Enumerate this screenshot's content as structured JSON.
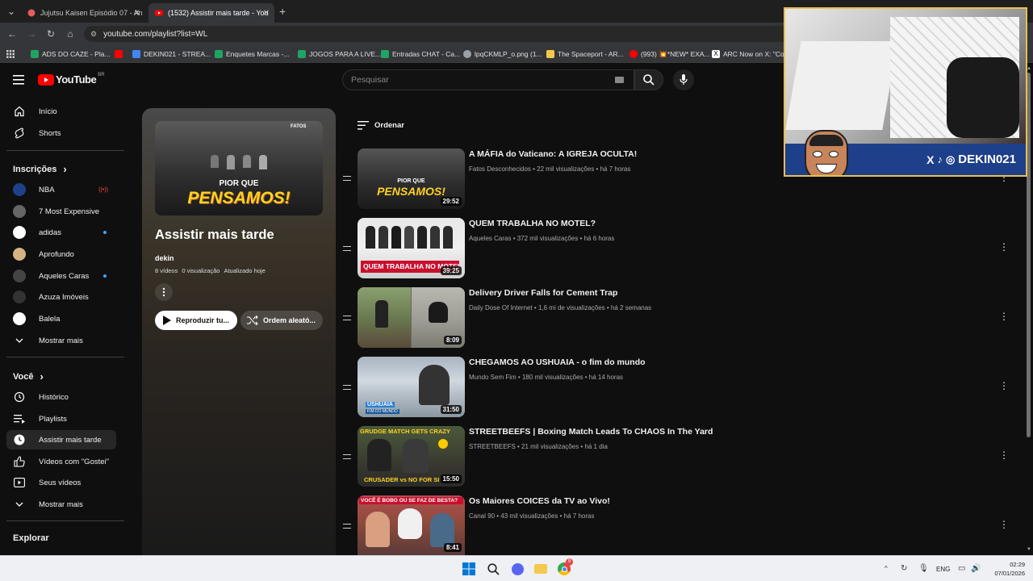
{
  "browser": {
    "tabs": [
      {
        "title": "Jujutsu Kaisen Episódio 07 - An",
        "active": false
      },
      {
        "title": "(1532) Assistir mais tarde - You",
        "active": true
      }
    ],
    "new_tab": "+",
    "url": "youtube.com/playlist?list=WL",
    "bookmarks": [
      {
        "label": "ADS DO CAZE - Pla...",
        "color": "#1fa463"
      },
      {
        "label": "",
        "color": "#ff0000"
      },
      {
        "label": "DEKIN021 - STREA...",
        "color": "#4285f4"
      },
      {
        "label": "Enquetes Marcas -...",
        "color": "#1fa463"
      },
      {
        "label": "JOGOS PARA A LIVE...",
        "color": "#1fa463"
      },
      {
        "label": "Entradas CHAT - Ca...",
        "color": "#1fa463"
      },
      {
        "label": "lpqCKMLP_o.png (1...",
        "color": "#9aa0a6"
      },
      {
        "label": "The Spaceport - AR...",
        "color": "#f2c94c"
      },
      {
        "label": "(993) 💥*NEW* EXA...",
        "color": "#ff0000"
      },
      {
        "label": "ARC Now on X: \"Co...",
        "color": "#ffffff"
      }
    ]
  },
  "youtube": {
    "logo_text": "YouTube",
    "region": "BR",
    "search_placeholder": "Pesquisar"
  },
  "sidebar": {
    "main": [
      {
        "label": "Início",
        "icon": "home-icon"
      },
      {
        "label": "Shorts",
        "icon": "shorts-icon"
      }
    ],
    "subs_header": "Inscrições",
    "subs_chevron": "›",
    "subscriptions": [
      {
        "label": "NBA",
        "color": "#1d428a",
        "live": true
      },
      {
        "label": "7 Most Expensive",
        "color": "#666666",
        "live": false
      },
      {
        "label": "adidas",
        "color": "#ffffff",
        "live": false,
        "dot": true
      },
      {
        "label": "Aprofundo",
        "color": "#d4b483",
        "live": false
      },
      {
        "label": "Aqueles Caras",
        "color": "#444444",
        "live": false,
        "dot": true
      },
      {
        "label": "Azuza Imóveis",
        "color": "#333333",
        "live": false
      },
      {
        "label": "Balela",
        "color": "#ffffff",
        "live": false
      }
    ],
    "show_more_1": "Mostrar mais",
    "you_header": "Você",
    "you_chevron": "›",
    "you_items": [
      {
        "label": "Histórico",
        "icon": "history-icon"
      },
      {
        "label": "Playlists",
        "icon": "playlists-icon"
      },
      {
        "label": "Assistir mais tarde",
        "icon": "watch-later-icon",
        "active": true
      },
      {
        "label": "Vídeos com \"Gostei\"",
        "icon": "like-icon"
      },
      {
        "label": "Seus vídeos",
        "icon": "your-videos-icon"
      }
    ],
    "show_more_2": "Mostrar mais",
    "explore_header": "Explorar"
  },
  "playlist": {
    "title": "Assistir mais tarde",
    "owner": "dekin",
    "videos_count": "8 vídeos",
    "views": "0 visualização",
    "updated": "Atualizado hoje",
    "play_all": "Reproduzir tu...",
    "shuffle": "Ordem aleató...",
    "cover_text_1": "PIOR QUE",
    "cover_text_2": "PENSAMOS!",
    "cover_logo": "FATOS"
  },
  "sort_label": "Ordenar",
  "videos": [
    {
      "title": "A MÁFIA do Vaticano: A IGREJA OCULTA!",
      "channel": "Fatos Desconhecidos",
      "views": "22 mil visualizações",
      "age": "há 7 horas",
      "duration": "29:52",
      "thumb_text_1": "PIOR QUE",
      "thumb_text_2": "PENSAMOS!"
    },
    {
      "title": "QUEM TRABALHA NO MOTEL?",
      "channel": "Aqueles Caras",
      "views": "372 mil visualizações",
      "age": "há 6 horas",
      "duration": "39:25",
      "thumb_text_1": "QUEM TRABALHA NO MOTEL?",
      "thumb_text_2": ""
    },
    {
      "title": "Delivery Driver Falls for Cement Trap",
      "channel": "Daily Dose Of Internet",
      "views": "1,6 mi de visualizações",
      "age": "há 2 semanas",
      "duration": "8:09",
      "thumb_text_1": "",
      "thumb_text_2": ""
    },
    {
      "title": "CHEGAMOS AO USHUAIA - o fim do mundo",
      "channel": "Mundo Sem Fim",
      "views": "180 mil visualizações",
      "age": "há 14 horas",
      "duration": "31:50",
      "thumb_text_1": "USHUAIA",
      "thumb_text_2": "FIM DO MUNDO"
    },
    {
      "title": "STREETBEEFS | Boxing Match Leads To CHAOS In The Yard",
      "channel": "STREETBEEFS",
      "views": "21 mil visualizações",
      "age": "há 1 dia",
      "duration": "15:50",
      "thumb_text_1": "GRUDGE MATCH GETS CRAZY",
      "thumb_text_2": "CRUSADER vs NO FOR SI"
    },
    {
      "title": "Os Maiores COICES da TV ao Vivo!",
      "channel": "Canal 90",
      "views": "43 mil visualizações",
      "age": "há 7 horas",
      "duration": "8:41",
      "thumb_text_1": "VOCÊ É BOBO OU SE FAZ DE BESTA?",
      "thumb_text_2": ""
    }
  ],
  "overlay": {
    "handle": "DEKIN021"
  },
  "taskbar": {
    "lang": "ENG",
    "time": "02:29",
    "date": "07/01/2026",
    "chat_badge": "9"
  }
}
